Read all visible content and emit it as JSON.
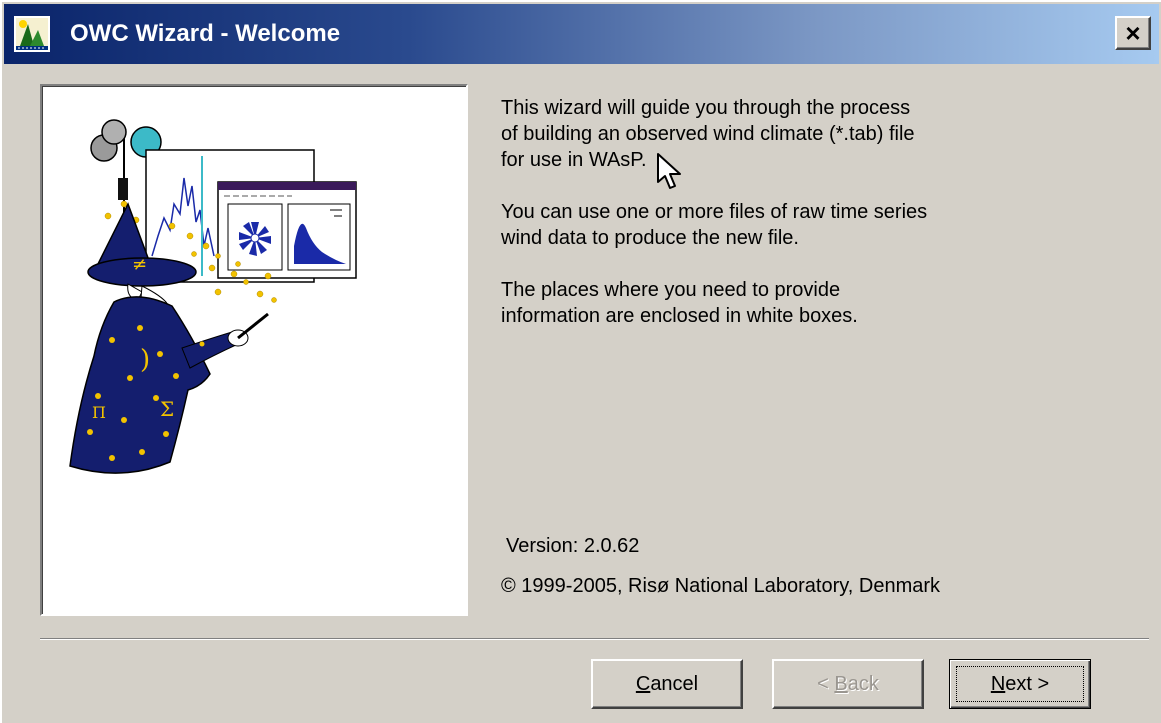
{
  "window": {
    "title": "OWC Wizard - Welcome",
    "close_label": "×"
  },
  "intro": {
    "paragraphs": [
      "This wizard will guide you through the process\nof building an observed wind climate (*.tab) file\nfor use in WAsP.",
      "You can use one or more files of raw time series\nwind data to produce the new file.",
      "The places where you need to provide\ninformation are enclosed in white boxes."
    ]
  },
  "about": {
    "version": "Version: 2.0.62",
    "copyright": "© 1999-2005, Risø National Laboratory, Denmark"
  },
  "buttons": {
    "cancel": {
      "underlined": "C",
      "rest": "ancel"
    },
    "back": {
      "prefix": "< ",
      "underlined": "B",
      "rest": "ack"
    },
    "next": {
      "underlined": "N",
      "rest": "ext >"
    }
  },
  "illustration": {
    "symbols": [
      "≠",
      ")",
      "Σ",
      "Π"
    ]
  },
  "colors": {
    "title_gradient_start": "#0a246a",
    "title_gradient_end": "#a6caf0",
    "dialog_face": "#d4d0c8",
    "wizard_robe": "#141e6e",
    "star": "#f2c200"
  },
  "icons": [
    "wizard-app-icon",
    "close-icon",
    "wizard-illustration",
    "mouse-cursor-icon"
  ]
}
